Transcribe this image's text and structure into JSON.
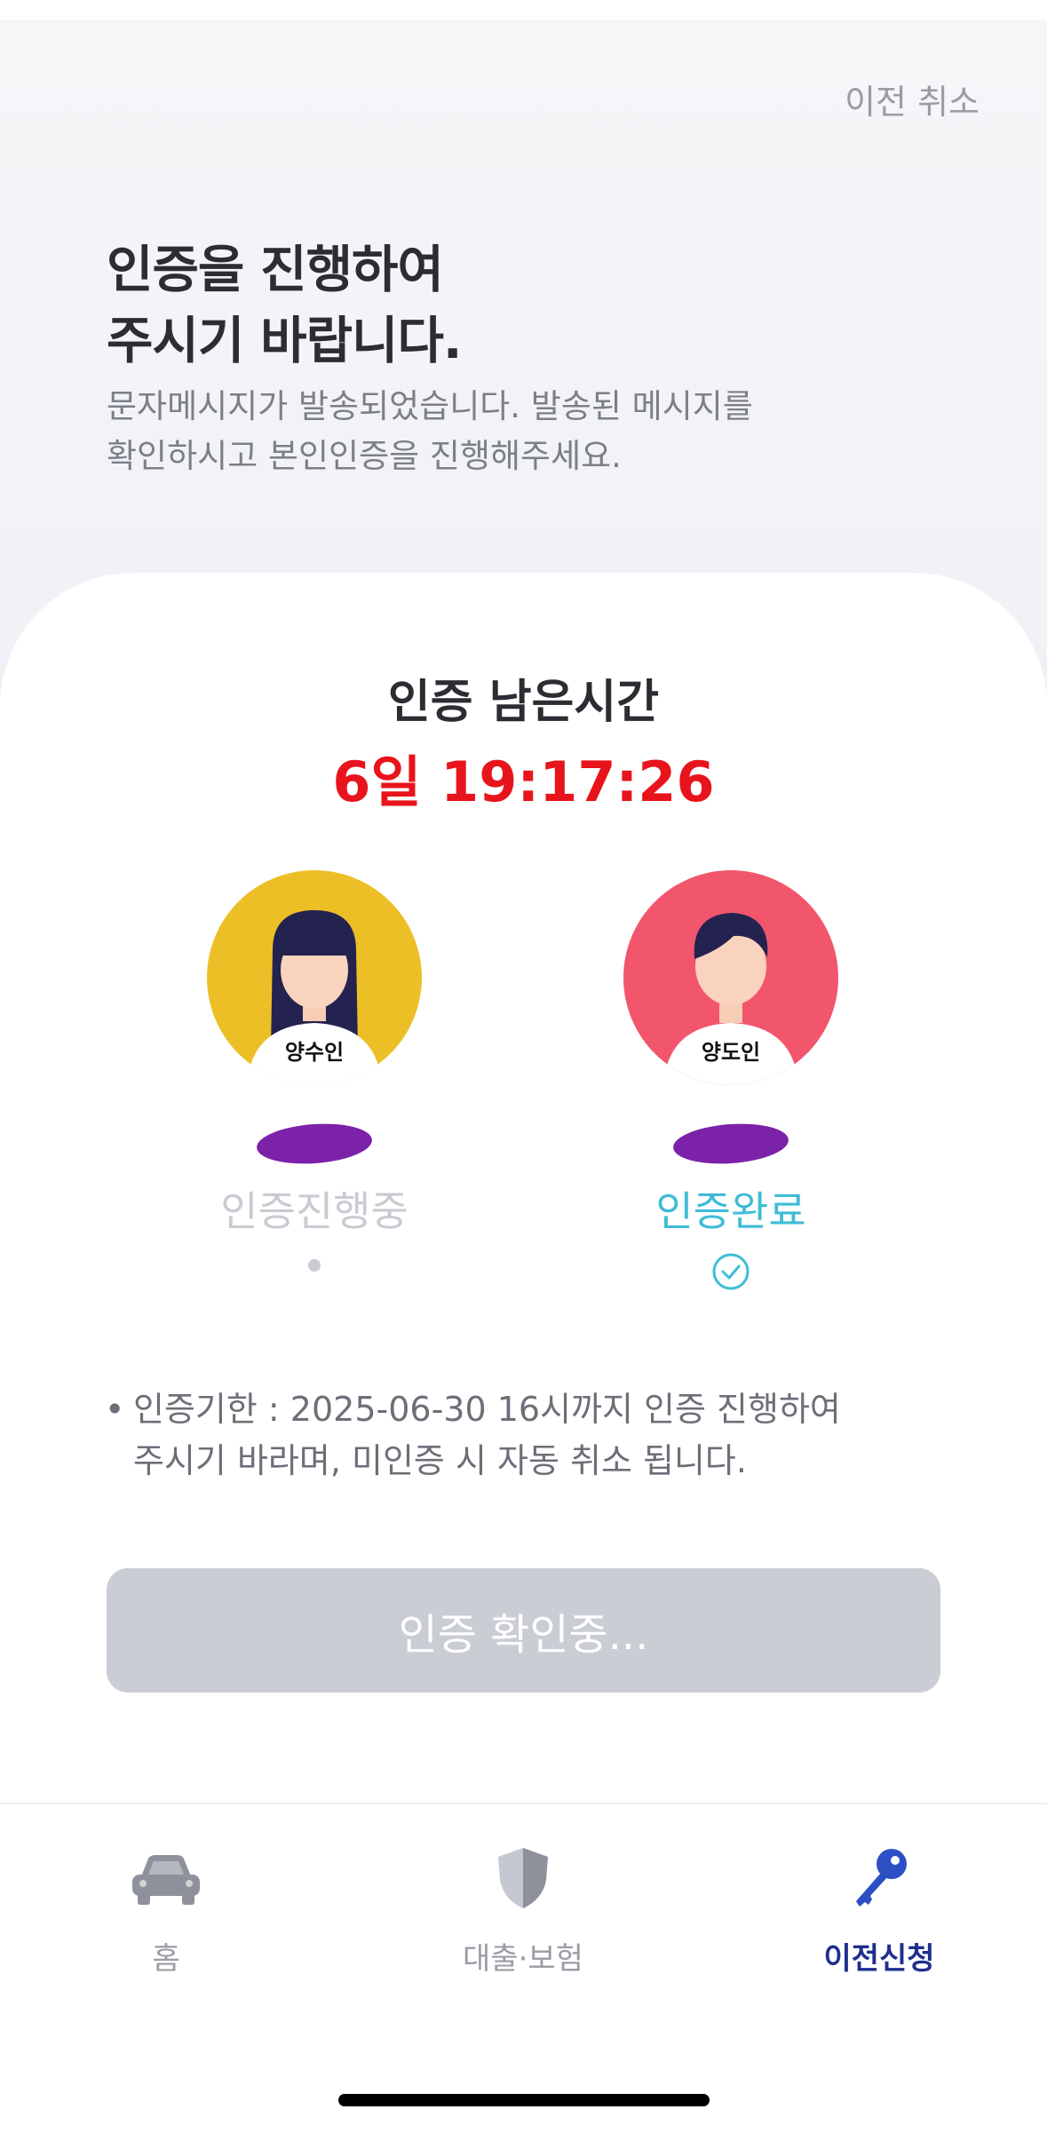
{
  "header": {
    "cancel_label": "이전 취소",
    "title_line1": "인증을 진행하여",
    "title_line2": "주시기 바랍니다.",
    "subtitle_line1": "문자메시지가 발송되었습니다. 발송된 메시지를",
    "subtitle_line2": "확인하시고 본인인증을 진행해주세요."
  },
  "timer": {
    "label": "인증 남은시간",
    "value": "6일 19:17:26",
    "color": "#e8141c"
  },
  "parties": [
    {
      "role": "양수인",
      "status": "인증진행중",
      "avatar_color": "#ecbf27",
      "status_icon": "pending-dot-icon"
    },
    {
      "role": "양도인",
      "status": "인증완료",
      "avatar_color": "#f2566d",
      "status_icon": "check-circle-icon"
    }
  ],
  "notice": {
    "bullet": "•",
    "line1": "인증기한 : 2025-06-30 16시까지 인증 진행하여",
    "line2": "주시기 바라며, 미인증 시 자동 취소 됩니다."
  },
  "confirm_button": {
    "label": "인증 확인중..."
  },
  "tabbar": {
    "items": [
      {
        "label": "홈",
        "icon": "car-icon"
      },
      {
        "label": "대출·보험",
        "icon": "shield-icon"
      },
      {
        "label": "이전신청",
        "icon": "key-icon",
        "active": true
      }
    ],
    "active_color": "#1f2f8f"
  }
}
